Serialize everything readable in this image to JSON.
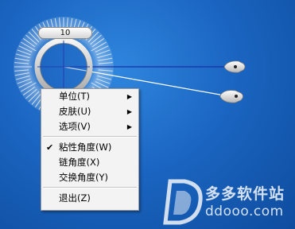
{
  "protractor": {
    "readout": "10"
  },
  "menu": {
    "items": [
      {
        "label": "单位(T)",
        "submenu": true,
        "checked": false
      },
      {
        "label": "皮肤(U)",
        "submenu": true,
        "checked": false
      },
      {
        "label": "选项(V)",
        "submenu": true,
        "checked": false
      },
      {
        "label": "粘性角度(W)",
        "submenu": false,
        "checked": true
      },
      {
        "label": "链角度(X)",
        "submenu": false,
        "checked": false
      },
      {
        "label": "交换角度(Y)",
        "submenu": false,
        "checked": false
      },
      {
        "label": "退出(Z)",
        "submenu": false,
        "checked": false
      }
    ],
    "arrow_glyph": "▶",
    "check_glyph": "✔"
  },
  "watermark": {
    "cn": "多多软件站",
    "en": "ddooo.com"
  },
  "colors": {
    "desktop": "#1b66c2",
    "baseline": "#1a2fa8",
    "arm": "#ffffff"
  }
}
